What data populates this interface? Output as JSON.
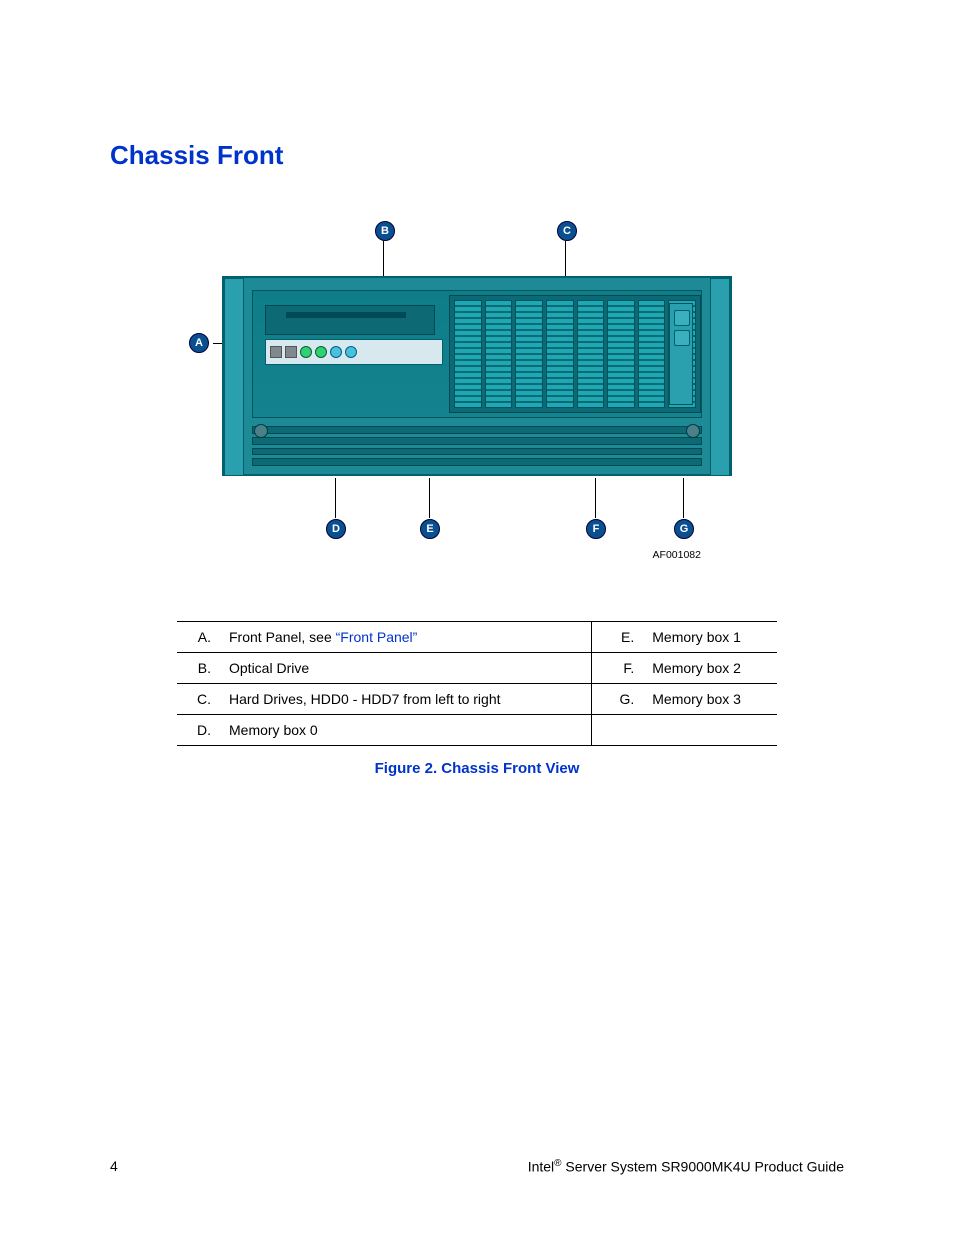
{
  "section_title": "Chassis Front",
  "figure_id": "AF001082",
  "callouts": {
    "A": "A",
    "B": "B",
    "C": "C",
    "D": "D",
    "E": "E",
    "F": "F",
    "G": "G"
  },
  "legend": {
    "left": [
      {
        "letter": "A.",
        "text_prefix": "Front Panel, see ",
        "link": "“Front Panel”"
      },
      {
        "letter": "B.",
        "text": "Optical Drive"
      },
      {
        "letter": "C.",
        "text": "Hard Drives, HDD0 - HDD7 from left to right"
      },
      {
        "letter": "D.",
        "text": "Memory box 0"
      }
    ],
    "right": [
      {
        "letter": "E.",
        "text": "Memory box 1"
      },
      {
        "letter": "F.",
        "text": "Memory box 2"
      },
      {
        "letter": "G.",
        "text": "Memory box 3"
      },
      {
        "letter": "",
        "text": ""
      }
    ]
  },
  "figure_caption": "Figure 2. Chassis Front View",
  "footer": {
    "page_number": "4",
    "brand": "Intel",
    "reg": "®",
    "product": " Server System SR9000MK4U Product Guide"
  }
}
